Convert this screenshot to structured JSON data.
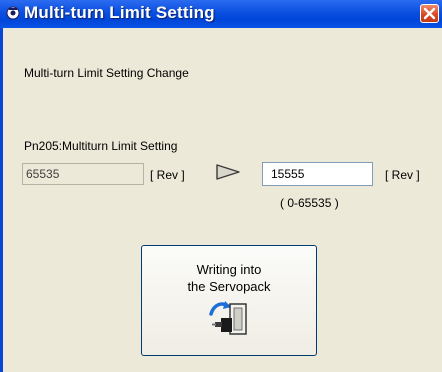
{
  "window": {
    "title": "Multi-turn Limit Setting"
  },
  "heading": "Multi-turn Limit Setting Change",
  "parameter": {
    "label": "Pn205:Multiturn Limit Setting",
    "current_value": "65535",
    "current_unit": "[ Rev ]",
    "new_value": "15555",
    "new_unit": "[ Rev ]",
    "range": "( 0-65535 )"
  },
  "write_button": {
    "line1": "Writing into",
    "line2": "the Servopack"
  },
  "icons": {
    "title": "app-icon",
    "close": "close-icon",
    "arrow": "arrow-right-icon",
    "write": "servopack-write-icon"
  },
  "colors": {
    "titlebar": "#0a4fe0",
    "close_button": "#d64520",
    "dialog_background": "#ece9d8"
  }
}
